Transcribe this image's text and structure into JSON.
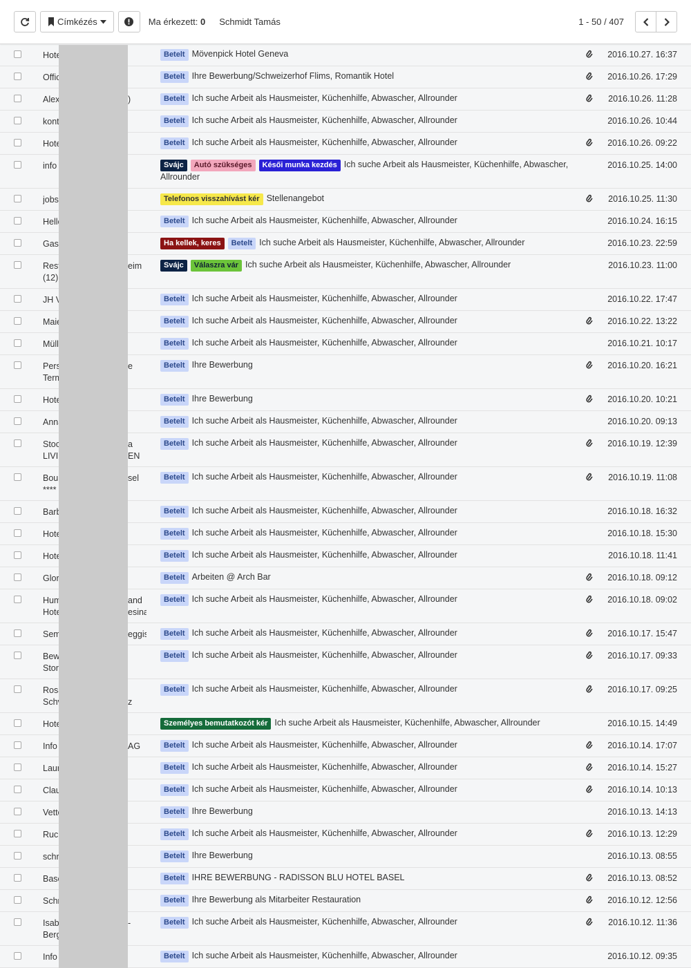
{
  "toolbar": {
    "label_button": "Címkézés",
    "today_label": "Ma érkezett:",
    "today_count": "0",
    "user": "Schmidt Tamás",
    "pager": "1 - 50 / 407"
  },
  "colors": {
    "Betelt": "#c9d6f9",
    "Svájc": "#0d2345",
    "Autó szükséges": "#f2a7bc",
    "Késői munka kezdés": "#2a21d6",
    "Telefonos visszahívást kér": "#f6e84b",
    "Ha kellek, keres": "#8b1313",
    "Válaszra vár": "#6cc43a",
    "Személyes bemutatkozót kér": "#156b3a"
  },
  "rows": [
    {
      "sender": "Hote",
      "tail": "",
      "tail2": "",
      "labels": [
        "Betelt"
      ],
      "subject": "Mövenpick Hotel Geneva",
      "attach": true,
      "date": "2016.10.27. 16:37"
    },
    {
      "sender": "Offic",
      "tail": "",
      "tail2": "",
      "labels": [
        "Betelt"
      ],
      "subject": "Ihre Bewerbung/Schweizerhof Flims, Romantik Hotel",
      "attach": true,
      "date": "2016.10.26. 17:29"
    },
    {
      "sender": "Alex",
      "tail": ")",
      "tail2": "",
      "labels": [
        "Betelt"
      ],
      "subject": "Ich suche Arbeit als Hausmeister, Küchenhilfe, Abwascher, Allrounder",
      "attach": true,
      "date": "2016.10.26. 11:28"
    },
    {
      "sender": "kont",
      "tail": "",
      "tail2": "",
      "labels": [
        "Betelt"
      ],
      "subject": "Ich suche Arbeit als Hausmeister, Küchenhilfe, Abwascher, Allrounder",
      "attach": false,
      "date": "2016.10.26. 10:44"
    },
    {
      "sender": "Hote",
      "tail": "",
      "tail2": "",
      "labels": [
        "Betelt"
      ],
      "subject": "Ich suche Arbeit als Hausmeister, Küchenhilfe, Abwascher, Allrounder",
      "attach": true,
      "date": "2016.10.26. 09:22"
    },
    {
      "sender": "info",
      "tail": "",
      "tail2": "",
      "labels": [
        "Svájc",
        "Autó szükséges",
        "Késői munka kezdés"
      ],
      "subject": "Ich suche Arbeit als Hausmeister, Küchenhilfe, Abwascher, Allrounder",
      "attach": false,
      "date": "2016.10.25. 14:00",
      "tall": true
    },
    {
      "sender": "jobs",
      "tail": "",
      "tail2": "",
      "labels": [
        "Telefonos visszahívást kér"
      ],
      "subject": "Stellenangebot",
      "attach": true,
      "date": "2016.10.25. 11:30"
    },
    {
      "sender": "Helle",
      "tail": "",
      "tail2": "",
      "labels": [
        "Betelt"
      ],
      "subject": "Ich suche Arbeit als Hausmeister, Küchenhilfe, Abwascher, Allrounder",
      "attach": false,
      "date": "2016.10.24. 16:15"
    },
    {
      "sender": "Gast",
      "tail": "",
      "tail2": "",
      "labels": [
        "Ha kellek, keres",
        "Betelt"
      ],
      "subject": "Ich suche Arbeit als Hausmeister, Küchenhilfe, Abwascher, Allrounder",
      "attach": false,
      "date": "2016.10.23. 22:59"
    },
    {
      "sender": "Rest",
      "sender2": "(12)",
      "tail": "eim",
      "tail2": "",
      "labels": [
        "Svájc",
        "Válaszra vár"
      ],
      "subject": "Ich suche Arbeit als Hausmeister, Küchenhilfe, Abwascher, Allrounder",
      "attach": false,
      "date": "2016.10.23. 11:00",
      "tall": true
    },
    {
      "sender": "JH V",
      "tail": "",
      "tail2": "",
      "labels": [
        "Betelt"
      ],
      "subject": "Ich suche Arbeit als Hausmeister, Küchenhilfe, Abwascher, Allrounder",
      "attach": false,
      "date": "2016.10.22. 17:47"
    },
    {
      "sender": "Maie",
      "tail": "",
      "tail2": "",
      "labels": [
        "Betelt"
      ],
      "subject": "Ich suche Arbeit als Hausmeister, Küchenhilfe, Abwascher, Allrounder",
      "attach": true,
      "date": "2016.10.22. 13:22"
    },
    {
      "sender": "Müll",
      "tail": "",
      "tail2": "",
      "labels": [
        "Betelt"
      ],
      "subject": "Ich suche Arbeit als Hausmeister, Küchenhilfe, Abwascher, Allrounder",
      "attach": false,
      "date": "2016.10.21. 10:17"
    },
    {
      "sender": "Pers",
      "sender2": "Term",
      "tail": "e",
      "tail2": "",
      "labels": [
        "Betelt"
      ],
      "subject": "Ihre Bewerbung",
      "attach": true,
      "date": "2016.10.20. 16:21",
      "tall": true
    },
    {
      "sender": "Hote",
      "tail": "",
      "tail2": "",
      "labels": [
        "Betelt"
      ],
      "subject": "Ihre Bewerbung",
      "attach": true,
      "date": "2016.10.20. 10:21"
    },
    {
      "sender": "Anna",
      "tail": "",
      "tail2": "",
      "labels": [
        "Betelt"
      ],
      "subject": "Ich suche Arbeit als Hausmeister, Küchenhilfe, Abwascher, Allrounder",
      "attach": false,
      "date": "2016.10.20. 09:13"
    },
    {
      "sender": "Stoc",
      "sender2": "LIVI",
      "tail": "a",
      "tail2": "EN",
      "labels": [
        "Betelt"
      ],
      "subject": "Ich suche Arbeit als Hausmeister, Küchenhilfe, Abwascher, Allrounder",
      "attach": true,
      "date": "2016.10.19. 12:39",
      "tall": true
    },
    {
      "sender": "Bou",
      "sender2": "****",
      "tail": "sel",
      "tail2": "",
      "labels": [
        "Betelt"
      ],
      "subject": "Ich suche Arbeit als Hausmeister, Küchenhilfe, Abwascher, Allrounder",
      "attach": true,
      "date": "2016.10.19. 11:08",
      "tall": true
    },
    {
      "sender": "Barb",
      "tail": "",
      "tail2": "",
      "labels": [
        "Betelt"
      ],
      "subject": "Ich suche Arbeit als Hausmeister, Küchenhilfe, Abwascher, Allrounder",
      "attach": false,
      "date": "2016.10.18. 16:32"
    },
    {
      "sender": "Hote",
      "tail": "",
      "tail2": "",
      "labels": [
        "Betelt"
      ],
      "subject": "Ich suche Arbeit als Hausmeister, Küchenhilfe, Abwascher, Allrounder",
      "attach": false,
      "date": "2016.10.18. 15:30"
    },
    {
      "sender": "Hote",
      "tail": "",
      "tail2": "",
      "labels": [
        "Betelt"
      ],
      "subject": "Ich suche Arbeit als Hausmeister, Küchenhilfe, Abwascher, Allrounder",
      "attach": false,
      "date": "2016.10.18. 11:41"
    },
    {
      "sender": "Glor",
      "tail": "",
      "tail2": "",
      "labels": [
        "Betelt"
      ],
      "subject": "Arbeiten @ Arch Bar",
      "attach": true,
      "date": "2016.10.18. 09:12"
    },
    {
      "sender": "Hum",
      "sender2": "Hote",
      "tail": "and",
      "tail2": "esina",
      "labels": [
        "Betelt"
      ],
      "subject": "Ich suche Arbeit als Hausmeister, Küchenhilfe, Abwascher, Allrounder",
      "attach": true,
      "date": "2016.10.18. 09:02",
      "tall": true
    },
    {
      "sender": "Sem",
      "tail": "eggis",
      "tail2": "",
      "labels": [
        "Betelt"
      ],
      "subject": "Ich suche Arbeit als Hausmeister, Küchenhilfe, Abwascher, Allrounder",
      "attach": true,
      "date": "2016.10.17. 15:47"
    },
    {
      "sender": "Bew",
      "sender2": "Stor",
      "tail": "",
      "tail2": "",
      "labels": [
        "Betelt"
      ],
      "subject": "Ich suche Arbeit als Hausmeister, Küchenhilfe, Abwascher, Allrounder",
      "attach": true,
      "date": "2016.10.17. 09:33",
      "tall": true
    },
    {
      "sender": "Rosa",
      "sender2": "Schv",
      "tail": "",
      "tail2": "z",
      "labels": [
        "Betelt"
      ],
      "subject": "Ich suche Arbeit als Hausmeister, Küchenhilfe, Abwascher, Allrounder",
      "attach": true,
      "date": "2016.10.17. 09:25",
      "tall": true
    },
    {
      "sender": "Hote",
      "tail": "",
      "tail2": "",
      "labels": [
        "Személyes bemutatkozót kér"
      ],
      "subject": "Ich suche Arbeit als Hausmeister, Küchenhilfe, Abwascher, Allrounder",
      "attach": false,
      "date": "2016.10.15. 14:49"
    },
    {
      "sender": "Info",
      "tail": "AG",
      "tail2": "",
      "labels": [
        "Betelt"
      ],
      "subject": "Ich suche Arbeit als Hausmeister, Küchenhilfe, Abwascher, Allrounder",
      "attach": true,
      "date": "2016.10.14. 17:07"
    },
    {
      "sender": "Laur",
      "tail": "",
      "tail2": "",
      "labels": [
        "Betelt"
      ],
      "subject": "Ich suche Arbeit als Hausmeister, Küchenhilfe, Abwascher, Allrounder",
      "attach": true,
      "date": "2016.10.14. 15:27"
    },
    {
      "sender": "Clau",
      "tail": "",
      "tail2": "",
      "labels": [
        "Betelt"
      ],
      "subject": "Ich suche Arbeit als Hausmeister, Küchenhilfe, Abwascher, Allrounder",
      "attach": true,
      "date": "2016.10.14. 10:13"
    },
    {
      "sender": "Vette",
      "tail": "",
      "tail2": "",
      "labels": [
        "Betelt"
      ],
      "subject": "Ihre Bewerbung",
      "attach": false,
      "date": "2016.10.13. 14:13"
    },
    {
      "sender": "Ruc",
      "tail": "",
      "tail2": "",
      "labels": [
        "Betelt"
      ],
      "subject": "Ich suche Arbeit als Hausmeister, Küchenhilfe, Abwascher, Allrounder",
      "attach": true,
      "date": "2016.10.13. 12:29"
    },
    {
      "sender": "schr",
      "tail": "",
      "tail2": "",
      "labels": [
        "Betelt"
      ],
      "subject": "Ihre Bewerbung",
      "attach": false,
      "date": "2016.10.13. 08:55"
    },
    {
      "sender": "Base",
      "tail": "",
      "tail2": "",
      "labels": [
        "Betelt"
      ],
      "subject": "IHRE BEWERBUNG - RADISSON BLU HOTEL BASEL",
      "attach": true,
      "date": "2016.10.13. 08:52"
    },
    {
      "sender": "Schr",
      "tail": "",
      "tail2": "",
      "labels": [
        "Betelt"
      ],
      "subject": "Ihre Bewerbung als Mitarbeiter Restauration",
      "attach": true,
      "date": "2016.10.12. 12:56"
    },
    {
      "sender": "Isab",
      "sender2": "Berg",
      "tail": "-",
      "tail2": "",
      "labels": [
        "Betelt"
      ],
      "subject": "Ich suche Arbeit als Hausmeister, Küchenhilfe, Abwascher, Allrounder",
      "attach": true,
      "date": "2016.10.12. 11:36",
      "tall": true
    },
    {
      "sender": "Info",
      "tail": "",
      "tail2": "",
      "labels": [
        "Betelt"
      ],
      "subject": "Ich suche Arbeit als Hausmeister, Küchenhilfe, Abwascher, Allrounder",
      "attach": false,
      "date": "2016.10.12. 09:35"
    }
  ]
}
